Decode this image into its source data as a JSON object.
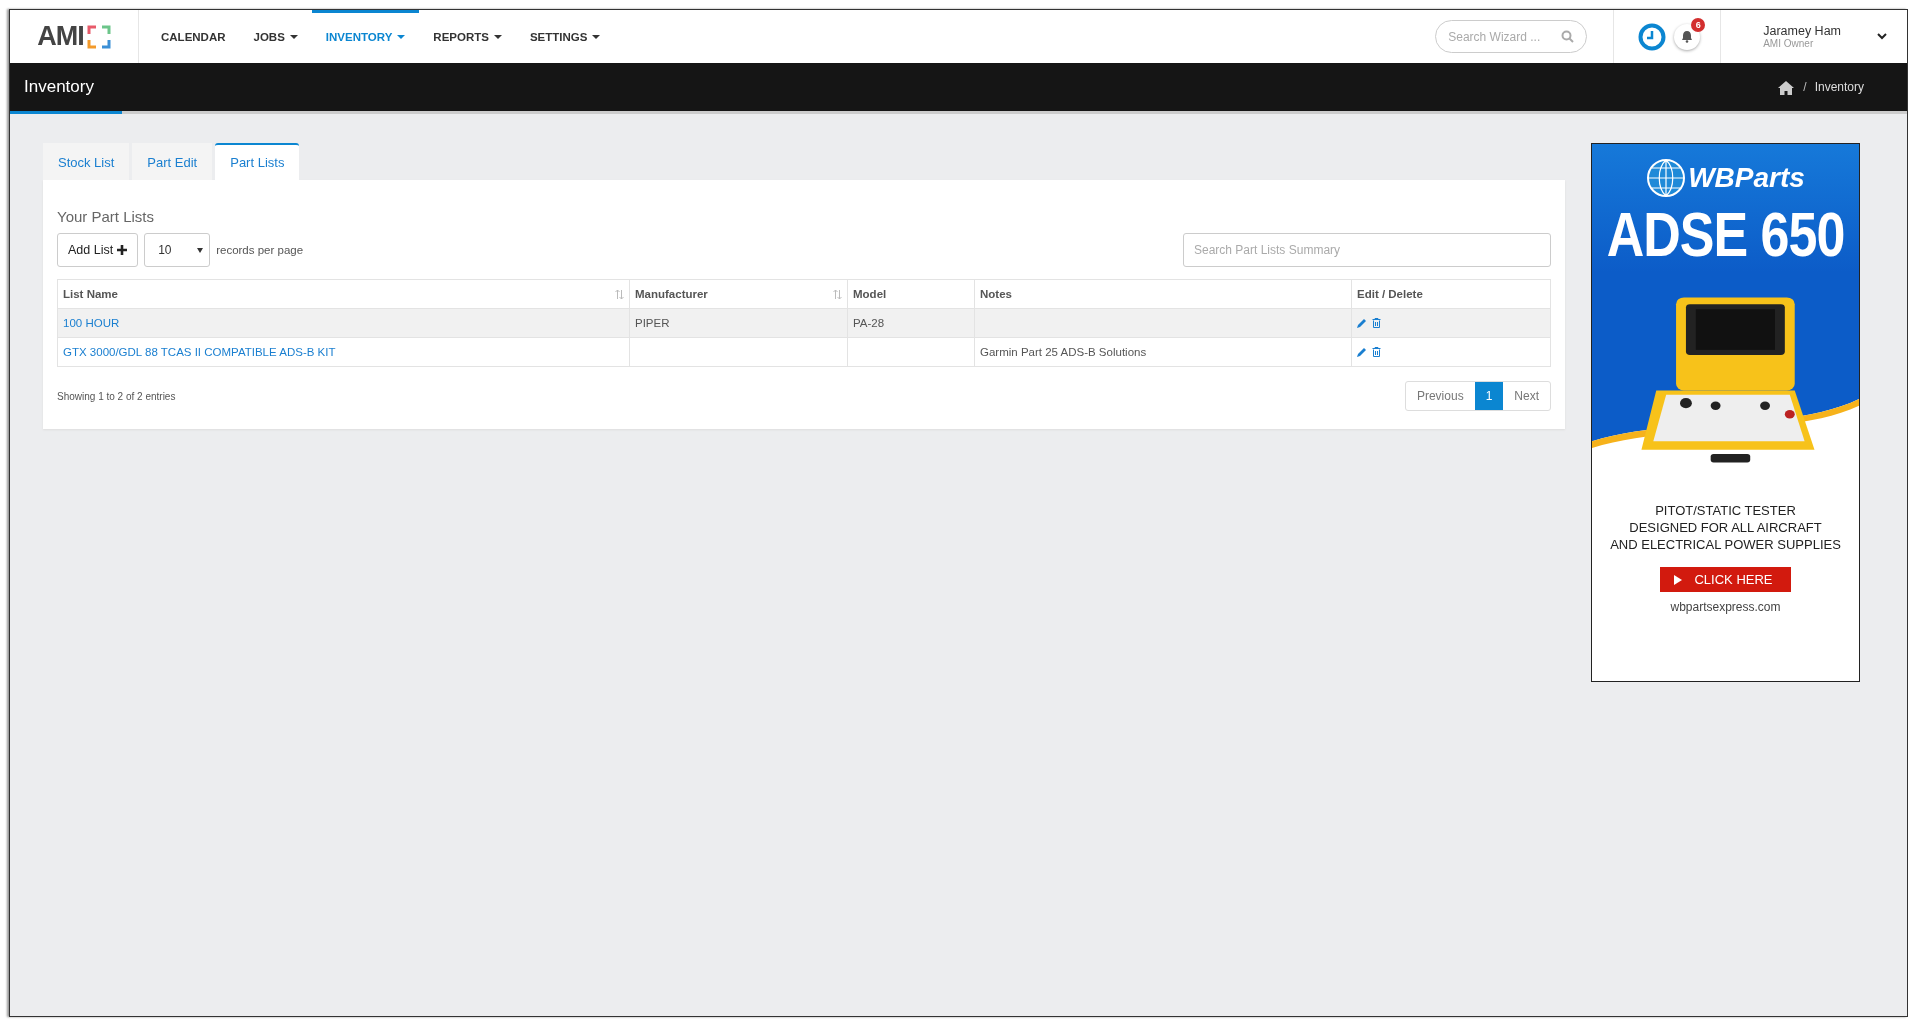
{
  "logo": {
    "text": "AMI"
  },
  "nav": [
    {
      "label": "CALENDAR",
      "caret": false,
      "selected": false
    },
    {
      "label": "JOBS",
      "caret": true,
      "selected": false
    },
    {
      "label": "INVENTORY",
      "caret": true,
      "selected": true
    },
    {
      "label": "REPORTS",
      "caret": true,
      "selected": false
    },
    {
      "label": "SETTINGS",
      "caret": true,
      "selected": false
    }
  ],
  "search": {
    "placeholder": "Search Wizard ..."
  },
  "notifications": {
    "count": "6"
  },
  "user": {
    "name": "Jaramey Ham",
    "role": "AMI Owner"
  },
  "page_title": "Inventory",
  "breadcrumb": [
    {
      "separator": "/",
      "label": "Inventory"
    }
  ],
  "tabs": [
    {
      "label": "Stock List",
      "selected": false
    },
    {
      "label": "Part Edit",
      "selected": false
    },
    {
      "label": "Part Lists",
      "selected": true
    }
  ],
  "panel": {
    "title": "Your Part Lists",
    "add_button": "Add List",
    "page_size": "10",
    "page_size_label": "records per page",
    "search_placeholder": "Search Part Lists Summary",
    "columns": [
      {
        "label": "List Name",
        "sortable": true
      },
      {
        "label": "Manufacturer",
        "sortable": true
      },
      {
        "label": "Model",
        "sortable": false
      },
      {
        "label": "Notes",
        "sortable": false
      },
      {
        "label": "Edit / Delete",
        "sortable": false
      }
    ],
    "rows": [
      {
        "list_name": "100 HOUR",
        "manufacturer": "PIPER",
        "model": "PA-28",
        "notes": ""
      },
      {
        "list_name": "GTX 3000/GDL 88 TCAS II COMPATIBLE ADS-B KIT",
        "manufacturer": "",
        "model": "",
        "notes": "Garmin Part 25 ADS-B Solutions"
      }
    ],
    "info": "Showing 1 to 2 of 2 entries",
    "pagination": {
      "previous": "Previous",
      "pages": [
        {
          "label": "1",
          "selected": true
        }
      ],
      "next": "Next"
    }
  },
  "ad": {
    "brand": "WBParts",
    "headline": "ADSE 650",
    "lines": [
      "PITOT/STATIC TESTER",
      "DESIGNED FOR ALL AIRCRAFT",
      "AND ELECTRICAL POWER SUPPLIES"
    ],
    "button": "CLICK HERE",
    "url": "wbpartsexpress.com"
  }
}
